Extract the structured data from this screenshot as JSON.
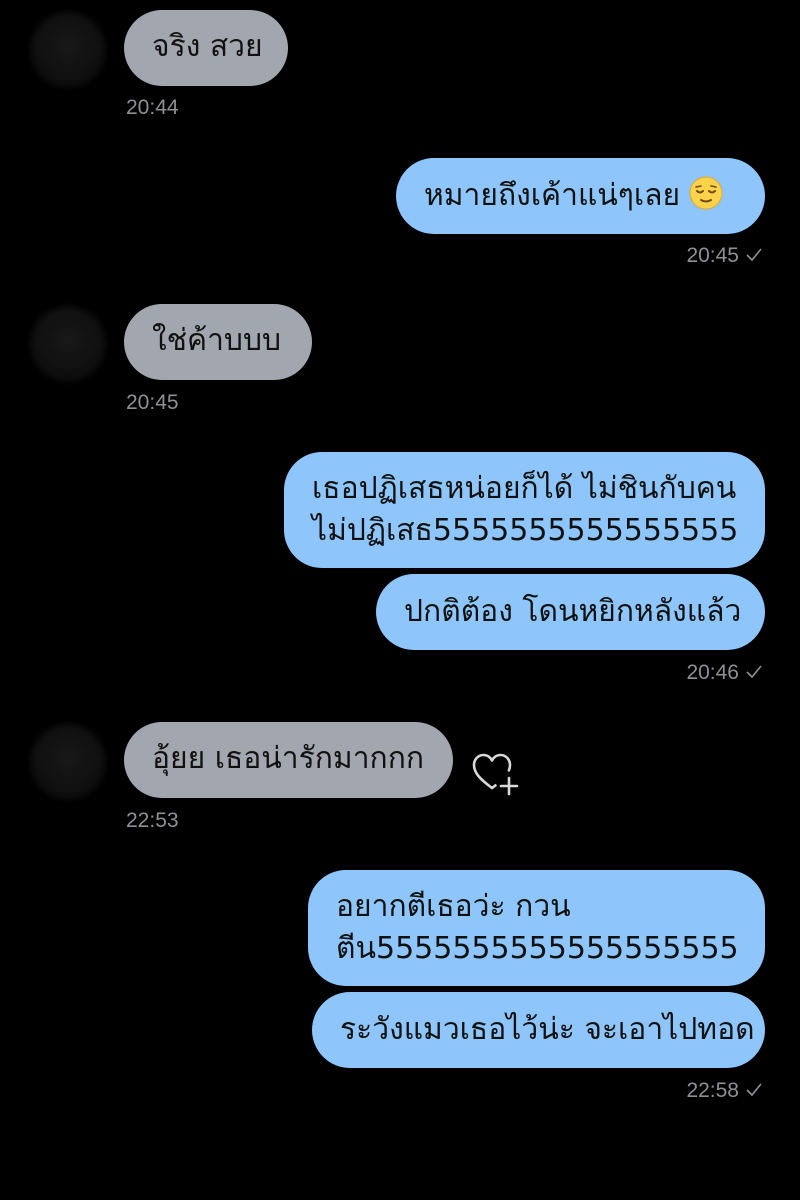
{
  "colors": {
    "background": "#000000",
    "incoming_bubble": "#a2a6ae",
    "outgoing_bubble": "#8ec6fb",
    "timestamp": "#8f8f94"
  },
  "messages": [
    {
      "direction": "incoming",
      "text": "จริง สวย",
      "time": "20:44"
    },
    {
      "direction": "outgoing",
      "text": "หมายถึงเค้าแน่ๆเลย",
      "emoji": "relieved-face-icon",
      "time": "20:45",
      "read_icon": "check-icon"
    },
    {
      "direction": "incoming",
      "text": "ใช่ค้าบบบ",
      "time": "20:45"
    },
    {
      "direction": "outgoing",
      "lines": [
        "เธอปฏิเสธหน่อยก็ได้ ไม่ชินกับคน",
        "ไม่ปฏิเสธ5555555555555555"
      ]
    },
    {
      "direction": "outgoing",
      "text": "ปกติต้อง โดนหยิกหลังแล้ว",
      "time": "20:46",
      "read_icon": "check-icon"
    },
    {
      "direction": "incoming",
      "text": "อุ้ยย เธอน่ารักมากกก",
      "time": "22:53",
      "reaction_icon": "heart-plus-icon"
    },
    {
      "direction": "outgoing",
      "lines": [
        "อยากตีเธอว่ะ กวน",
        "ตีน5555555555555555555"
      ]
    },
    {
      "direction": "outgoing",
      "text": "ระวังแมวเธอไว้น่ะ จะเอาไปทอด",
      "time": "22:58",
      "read_icon": "check-icon"
    }
  ]
}
